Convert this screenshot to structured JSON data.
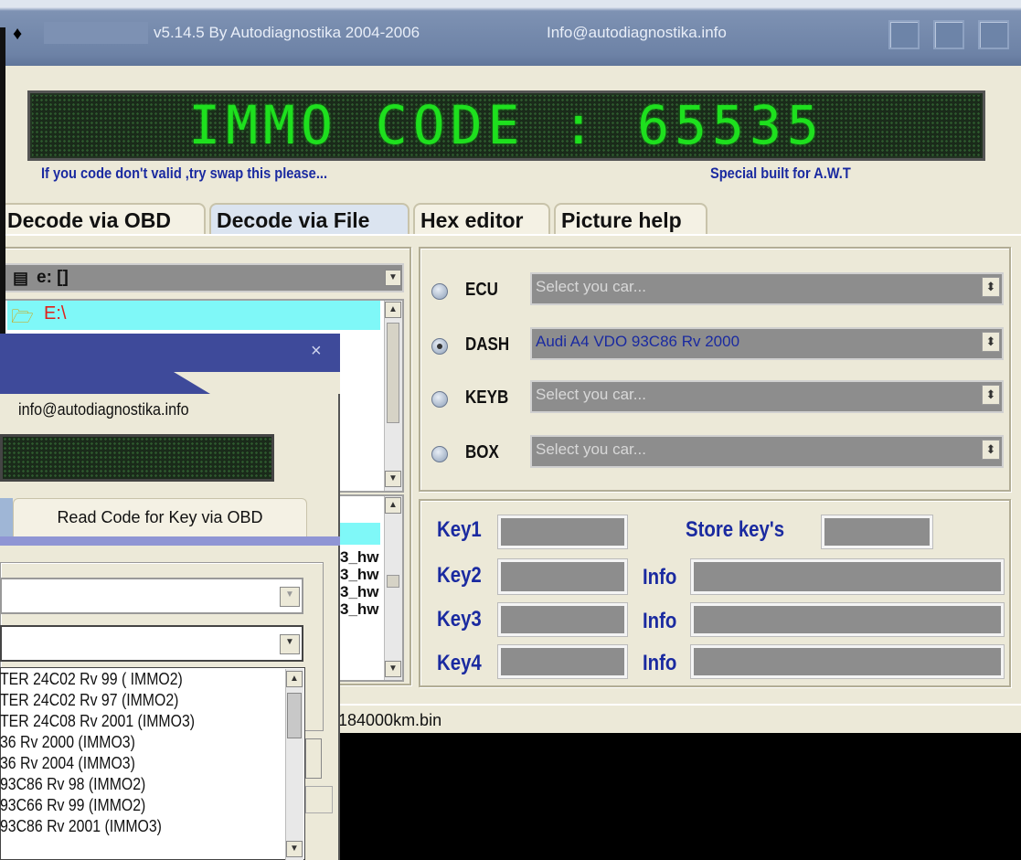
{
  "window": {
    "title_version": "v5.14.5  By  Autodiagnostika  2004-2006",
    "title_email": "Info@autodiagnostika.info",
    "led_text": "IMMO CODE : 65535",
    "hint_left": "If you code don't valid ,try swap this please...",
    "hint_right": "Special built for A.W.T"
  },
  "tabs": [
    "Decode via OBD",
    "Decode via File",
    "Hex editor",
    "Picture help"
  ],
  "drive": {
    "label": "e: []",
    "folder": "E:\\"
  },
  "files": [
    "3_hw",
    "3_hw",
    "3_hw",
    "3_hw"
  ],
  "modules": [
    {
      "label": "ECU",
      "value": "Select you car...",
      "selected": false
    },
    {
      "label": "DASH",
      "value": "Audi A4 VDO 93C86 Rv 2000",
      "selected": true
    },
    {
      "label": "KEYB",
      "value": "Select you car...",
      "selected": false
    },
    {
      "label": "BOX",
      "value": "Select you car...",
      "selected": false
    }
  ],
  "keys": {
    "key1": "Key1",
    "key2": "Key2",
    "key3": "Key3",
    "key4": "Key4",
    "store": "Store key's",
    "info": "Info"
  },
  "status_file": "184000km.bin",
  "dialog": {
    "close": "×",
    "email": "info@autodiagnostika.info",
    "tab_read": "Read   Code for Key via OBD",
    "options": [
      "TER 24C02 Rv 99  ( IMMO2)",
      "TER 24C02 Rv 97  (IMMO2)",
      "TER 24C08 Rv 2001 (IMMO3)",
      "36  Rv 2000  (IMMO3)",
      "36  Rv 2004 (IMMO3)",
      "93C86 Rv 98  (IMMO2)",
      "93C66 Rv 99  (IMMO2)",
      "93C86 Rv 2001 (IMMO3)"
    ]
  }
}
